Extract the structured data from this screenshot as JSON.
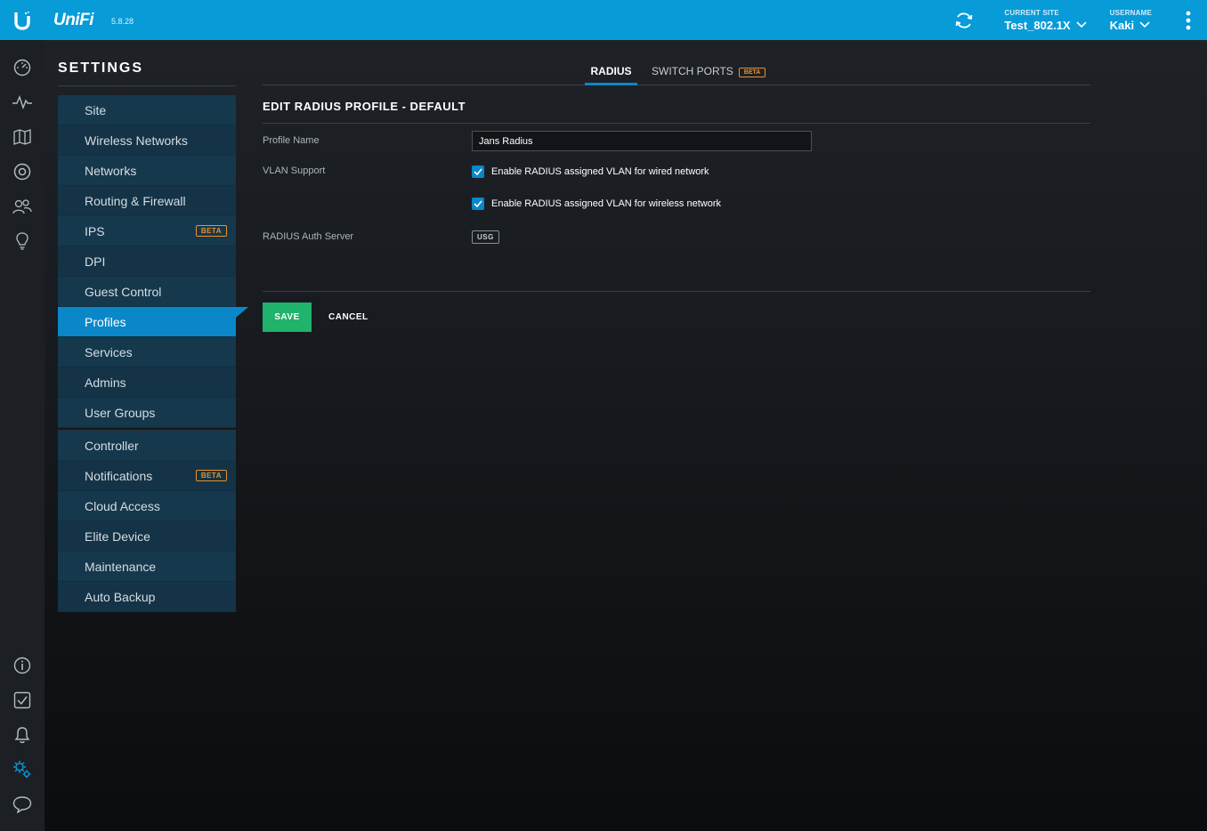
{
  "header": {
    "brand": "UniFi",
    "version": "5.8.28",
    "current_site_caption": "CURRENT SITE",
    "current_site": "Test_802.1X",
    "username_caption": "USERNAME",
    "username": "Kaki"
  },
  "rail": {
    "top_icons": [
      "dashboard-icon",
      "statistics-icon",
      "map-icon",
      "devices-icon",
      "clients-icon",
      "insights-icon"
    ],
    "bottom_icons": [
      "info-icon",
      "events-icon",
      "alerts-icon",
      "settings-icon",
      "chat-icon"
    ]
  },
  "settings_title": "SETTINGS",
  "menu": {
    "group1": [
      {
        "label": "Site"
      },
      {
        "label": "Wireless Networks"
      },
      {
        "label": "Networks"
      },
      {
        "label": "Routing & Firewall"
      },
      {
        "label": "IPS",
        "badge": "BETA"
      },
      {
        "label": "DPI"
      },
      {
        "label": "Guest Control"
      },
      {
        "label": "Profiles",
        "active": true
      },
      {
        "label": "Services"
      },
      {
        "label": "Admins"
      },
      {
        "label": "User Groups"
      }
    ],
    "group2": [
      {
        "label": "Controller"
      },
      {
        "label": "Notifications",
        "badge": "BETA"
      },
      {
        "label": "Cloud Access"
      },
      {
        "label": "Elite Device"
      },
      {
        "label": "Maintenance"
      },
      {
        "label": "Auto Backup"
      }
    ]
  },
  "tabs": {
    "radius": "RADIUS",
    "switch_ports": "SWITCH PORTS",
    "switch_ports_badge": "BETA"
  },
  "form": {
    "title": "EDIT RADIUS PROFILE - DEFAULT",
    "profile_name_label": "Profile Name",
    "profile_name_value": "Jans Radius",
    "vlan_support_label": "VLAN Support",
    "vlan_wired_label": "Enable RADIUS assigned VLAN for wired network",
    "vlan_wireless_label": "Enable RADIUS assigned VLAN for wireless network",
    "auth_server_label": "RADIUS Auth Server",
    "auth_server_badge": "USG",
    "save": "SAVE",
    "cancel": "CANCEL"
  },
  "colors": {
    "accent": "#079bd8",
    "active_item": "#0a87c8",
    "save_button": "#1fb36b",
    "beta_badge": "#e8912d"
  }
}
